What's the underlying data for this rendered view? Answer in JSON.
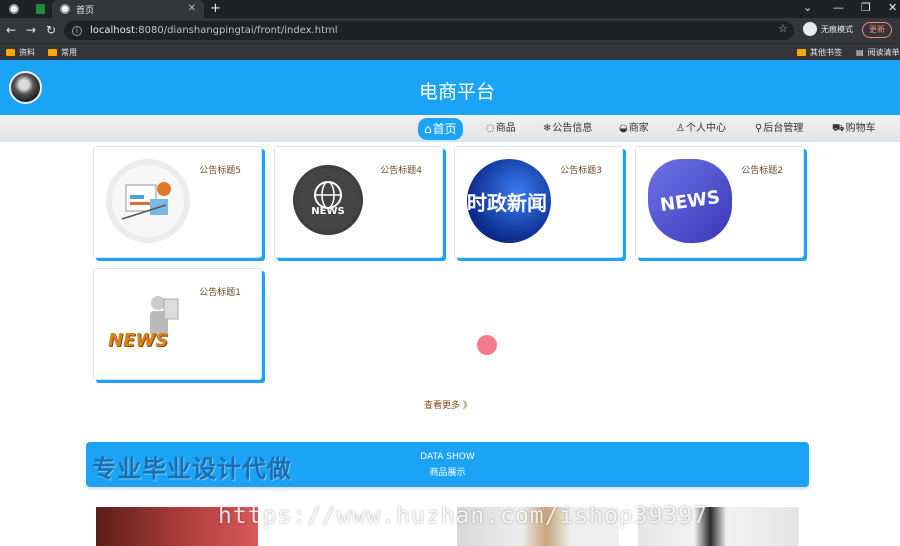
{
  "browser": {
    "active_tab_title": "首页",
    "url_host": "localhost",
    "url_rest": ":8080/dianshangpingtai/front/index.html",
    "incognito_label": "无痕模式",
    "update_label": "更新",
    "bookmarks": [
      "资料",
      "常用",
      "其他书签",
      "阅读清单"
    ]
  },
  "header": {
    "title": "电商平台"
  },
  "menu": [
    {
      "label": "首页",
      "icon": "⌂"
    },
    {
      "label": "商品",
      "icon": "◌"
    },
    {
      "label": "公告信息",
      "icon": "❄"
    },
    {
      "label": "商家",
      "icon": "◒"
    },
    {
      "label": "个人中心",
      "icon": "♙"
    },
    {
      "label": "后台管理",
      "icon": "⚲"
    },
    {
      "label": "购物车",
      "icon": "⛟"
    }
  ],
  "news": [
    {
      "title": "公告标题5",
      "icon": "newspaper-icon"
    },
    {
      "title": "公告标题4",
      "icon": "globe-news-icon",
      "thumb_text": "NEWS"
    },
    {
      "title": "公告标题3",
      "icon": "news-broadcast-icon",
      "thumb_text": "时政新闻"
    },
    {
      "title": "公告标题2",
      "icon": "news-apple-icon",
      "thumb_text": "NEWS"
    },
    {
      "title": "公告标题1",
      "icon": "news-figure-icon",
      "thumb_text": "NEWS"
    }
  ],
  "more_label": "查看更多 》",
  "banner": {
    "title": "专业毕业设计代做",
    "subtitle_en": "DATA SHOW",
    "subtitle_zh": "商品展示"
  },
  "watermark": "https://www.huzhan.com/ishop39397",
  "colors": {
    "primary": "#1ba4f5",
    "brown_text": "#6b4a2a"
  }
}
